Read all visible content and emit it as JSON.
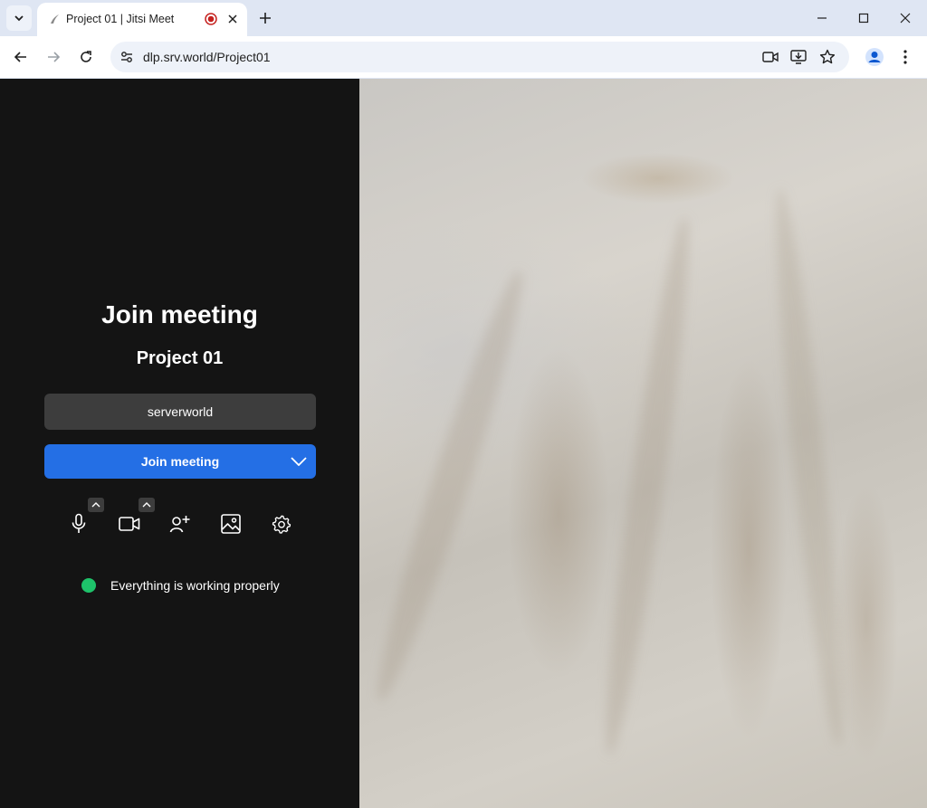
{
  "browser": {
    "tab": {
      "title": "Project 01 | Jitsi Meet"
    },
    "url": "dlp.srv.world/Project01"
  },
  "prejoin": {
    "heading": "Join meeting",
    "room_name": "Project 01",
    "display_name_input": {
      "value": "serverworld"
    },
    "join_button": {
      "label": "Join meeting"
    },
    "controls": [
      "microphone-icon",
      "camera-icon",
      "invite-icon",
      "background-icon",
      "settings-icon"
    ],
    "status": {
      "text": "Everything is working properly",
      "color": "#1ec26a"
    }
  },
  "colors": {
    "accent": "#246fe5",
    "panel_bg": "#141414",
    "input_bg": "#3d3d3d"
  }
}
